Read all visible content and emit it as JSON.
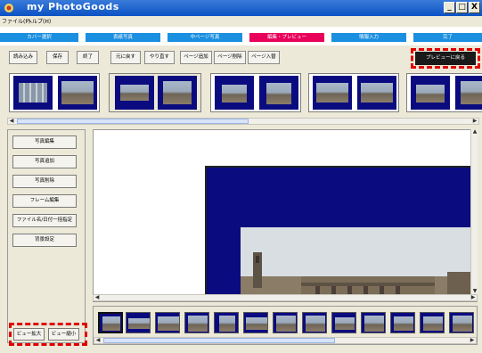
{
  "window": {
    "title": "my PhotoGoods",
    "buttons": {
      "minimize": "_",
      "maximize": "□",
      "close": "X"
    }
  },
  "menu": {
    "items": [
      {
        "label": "ファイル(F)"
      },
      {
        "label": "ヘルプ(H)"
      }
    ]
  },
  "steps": [
    {
      "label": "カバー選択"
    },
    {
      "label": "表紙写真"
    },
    {
      "label": "中ページ写真"
    },
    {
      "label": "編集・プレビュー"
    },
    {
      "label": "情報入力"
    },
    {
      "label": "完了"
    }
  ],
  "toolbar": {
    "load": "読み込み",
    "save": "保存",
    "exit": "終了",
    "undo": "元に戻す",
    "redo": "やり直す",
    "add_page": "ページ追加",
    "delete_page": "ページ削除",
    "swap_page": "ページ入替",
    "back_to_preview": "プレビューに戻る"
  },
  "left_panel": {
    "edit_photo": "写真編集",
    "add_photo": "写真追加",
    "delete_photo": "写真削除",
    "edit_frame": "フレーム編集",
    "filename_date": "ファイル名/日付一括指定",
    "background": "背景設定",
    "zoom_in": "ビュー拡大",
    "zoom_out": "ビュー縮小"
  },
  "colors": {
    "step_active": "#e8005a",
    "step_default": "#1b8fe0",
    "page_bg": "#0b0b80",
    "highlight": "#e00000"
  }
}
